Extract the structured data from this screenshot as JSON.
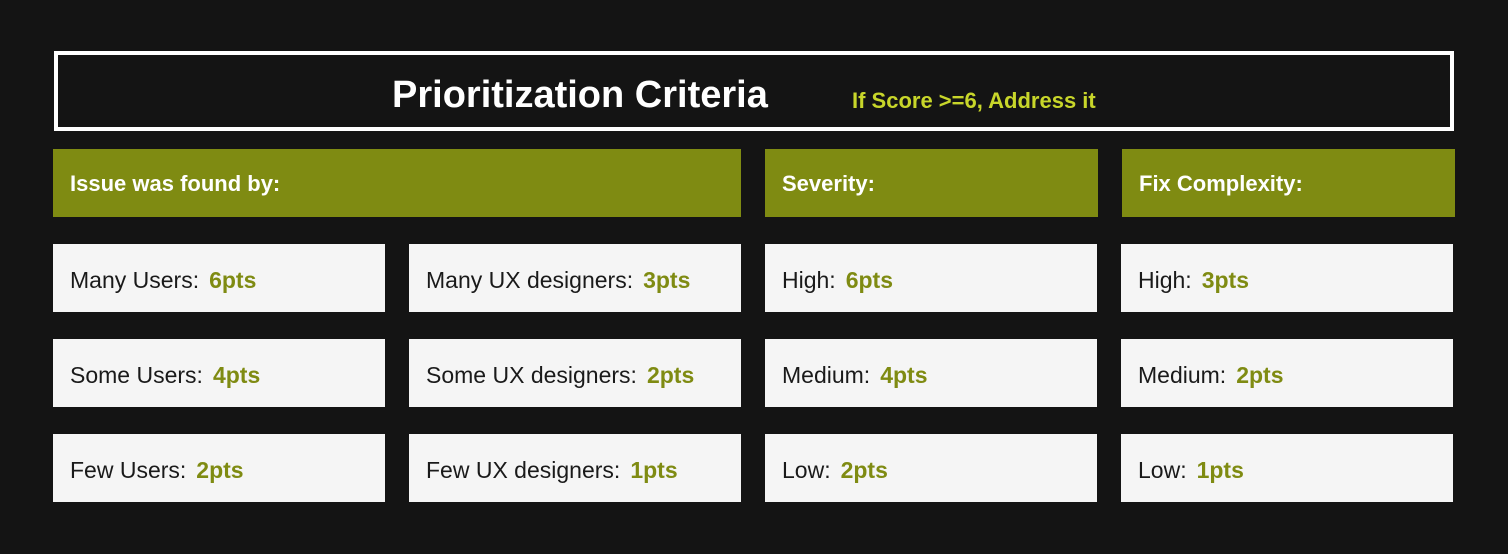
{
  "title": "Prioritization Criteria",
  "subtitle": "If Score >=6, Address it",
  "headers": {
    "found_by": "Issue was found by:",
    "severity": "Severity:",
    "fix_complexity": "Fix Complexity:"
  },
  "found_by_users": [
    {
      "label": "Many Users:",
      "points": "6pts"
    },
    {
      "label": "Some Users:",
      "points": "4pts"
    },
    {
      "label": "Few Users:",
      "points": "2pts"
    }
  ],
  "found_by_designers": [
    {
      "label": "Many UX designers:",
      "points": "3pts"
    },
    {
      "label": "Some UX designers:",
      "points": "2pts"
    },
    {
      "label": "Few UX designers:",
      "points": "1pts"
    }
  ],
  "severity": [
    {
      "label": "High:",
      "points": "6pts"
    },
    {
      "label": "Medium:",
      "points": "4pts"
    },
    {
      "label": "Low:",
      "points": "2pts"
    }
  ],
  "fix_complexity": [
    {
      "label": "High:",
      "points": "3pts"
    },
    {
      "label": "Medium:",
      "points": "2pts"
    },
    {
      "label": "Low:",
      "points": "1pts"
    }
  ],
  "colors": {
    "background": "#141414",
    "accent": "#7f8b12",
    "subtitle": "#c8d62a",
    "cell": "#f5f5f5"
  }
}
